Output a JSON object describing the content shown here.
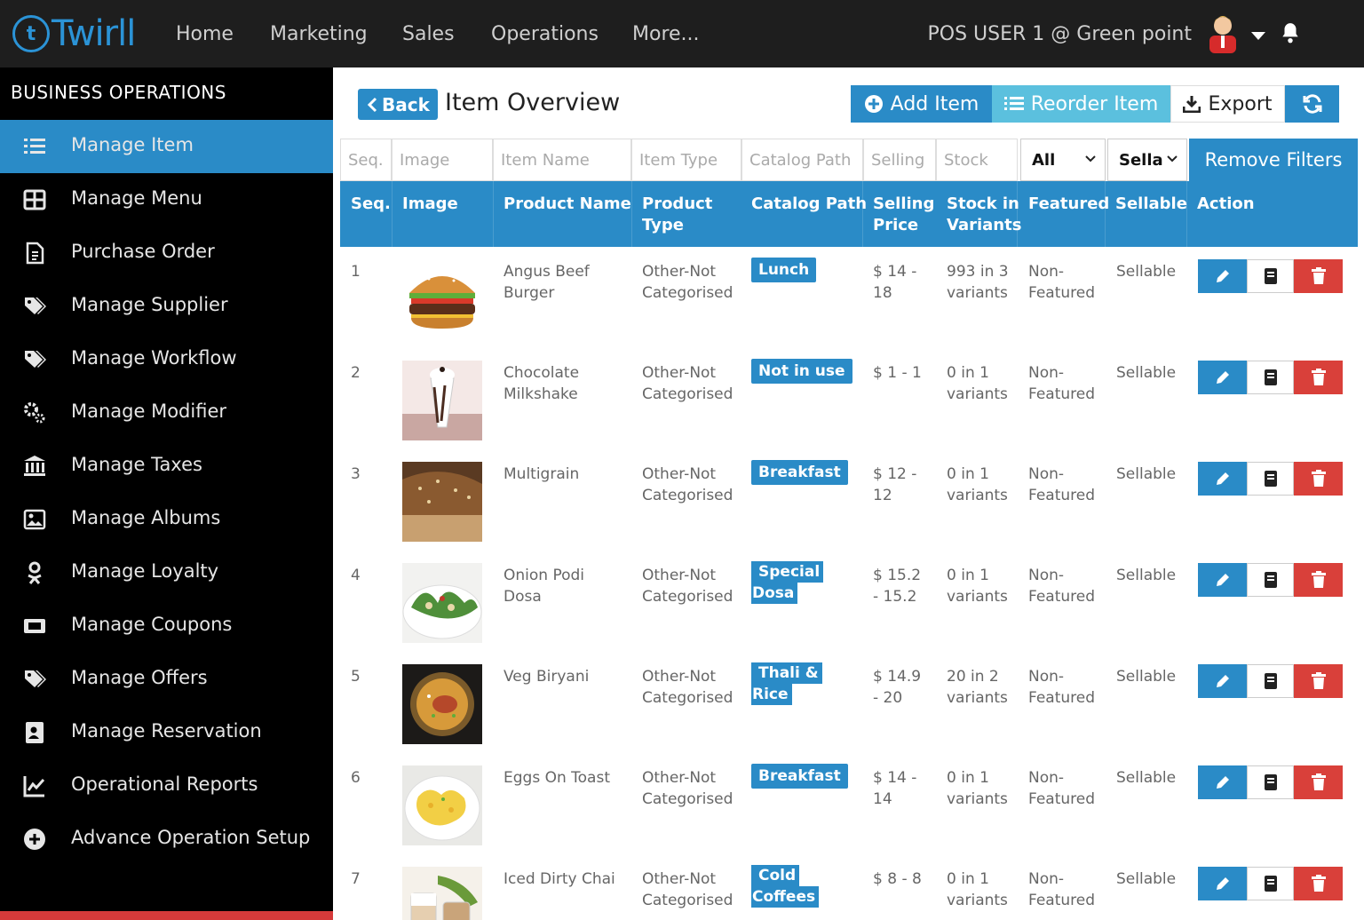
{
  "app": {
    "logo_mark": "t",
    "logo_text": "Twirll"
  },
  "nav": {
    "items": [
      "Home",
      "Marketing",
      "Sales",
      "Operations",
      "More..."
    ]
  },
  "user": {
    "label": "POS USER 1 @ Green point"
  },
  "sidebar": {
    "title": "BUSINESS OPERATIONS",
    "items": [
      {
        "label": "Manage Item",
        "icon": "list-icon",
        "active": true
      },
      {
        "label": "Manage Menu",
        "icon": "grid-icon"
      },
      {
        "label": "Purchase Order",
        "icon": "document-icon"
      },
      {
        "label": "Manage Supplier",
        "icon": "tags-icon"
      },
      {
        "label": "Manage Workflow",
        "icon": "tags-icon"
      },
      {
        "label": "Manage Modifier",
        "icon": "gears-icon"
      },
      {
        "label": "Manage Taxes",
        "icon": "bank-icon"
      },
      {
        "label": "Manage Albums",
        "icon": "image-icon"
      },
      {
        "label": "Manage Loyalty",
        "icon": "person-icon"
      },
      {
        "label": "Manage Coupons",
        "icon": "ticket-icon"
      },
      {
        "label": "Manage Offers",
        "icon": "tags-icon"
      },
      {
        "label": "Manage Reservation",
        "icon": "contact-icon"
      },
      {
        "label": "Operational Reports",
        "icon": "chart-icon"
      },
      {
        "label": "Advance Operation Setup",
        "icon": "plus-circle-icon"
      }
    ]
  },
  "header": {
    "back": "Back",
    "title": "Item Overview",
    "add": "Add Item",
    "reorder": "Reorder Item",
    "export": "Export"
  },
  "filters": {
    "seq": "Seq.",
    "image": "Image",
    "item_name": "Item Name",
    "item_type": "Item Type",
    "catalog_path": "Catalog Path",
    "selling": "Selling",
    "stock": "Stock",
    "featured_select": "All",
    "sellable_select": "Sella",
    "remove": "Remove Filters"
  },
  "columns": {
    "seq": "Seq.",
    "image": "Image",
    "name": "Product Name",
    "type_1": "Product",
    "type_2": "Type",
    "catalog": "Catalog Path",
    "price_1": "Selling",
    "price_2": "Price",
    "stock_1": "Stock in",
    "stock_2": "Variants",
    "featured": "Featured",
    "sellable": "Sellable",
    "action": "Action"
  },
  "rows": [
    {
      "seq": "1",
      "name_1": "Angus Beef",
      "name_2": "Burger",
      "type_1": "Other-Not",
      "type_2": "Categorised",
      "catalog_1": "Lunch",
      "catalog_2": "",
      "price_1": "$ 14 -",
      "price_2": "18",
      "stock_1": "993 in 3",
      "stock_2": "variants",
      "featured_1": "Non-",
      "featured_2": "Featured",
      "sellable": "Sellable"
    },
    {
      "seq": "2",
      "name_1": "Chocolate",
      "name_2": "Milkshake",
      "type_1": "Other-Not",
      "type_2": "Categorised",
      "catalog_1": "Not in use",
      "catalog_2": "",
      "price_1": "$ 1 - 1",
      "price_2": "",
      "stock_1": "0 in 1",
      "stock_2": "variants",
      "featured_1": "Non-",
      "featured_2": "Featured",
      "sellable": "Sellable"
    },
    {
      "seq": "3",
      "name_1": "Multigrain",
      "name_2": "",
      "type_1": "Other-Not",
      "type_2": "Categorised",
      "catalog_1": "Breakfast",
      "catalog_2": "",
      "price_1": "$ 12 -",
      "price_2": "12",
      "stock_1": "0 in 1",
      "stock_2": "variants",
      "featured_1": "Non-",
      "featured_2": "Featured",
      "sellable": "Sellable"
    },
    {
      "seq": "4",
      "name_1": "Onion Podi",
      "name_2": "Dosa",
      "type_1": "Other-Not",
      "type_2": "Categorised",
      "catalog_1": "Special",
      "catalog_2": "Dosa",
      "price_1": "$ 15.2",
      "price_2": "- 15.2",
      "stock_1": "0 in 1",
      "stock_2": "variants",
      "featured_1": "Non-",
      "featured_2": "Featured",
      "sellable": "Sellable"
    },
    {
      "seq": "5",
      "name_1": "Veg Biryani",
      "name_2": "",
      "type_1": "Other-Not",
      "type_2": "Categorised",
      "catalog_1": "Thali &",
      "catalog_2": "Rice",
      "price_1": "$ 14.9",
      "price_2": "- 20",
      "stock_1": "20 in 2",
      "stock_2": "variants",
      "featured_1": "Non-",
      "featured_2": "Featured",
      "sellable": "Sellable"
    },
    {
      "seq": "6",
      "name_1": "Eggs On Toast",
      "name_2": "",
      "type_1": "Other-Not",
      "type_2": "Categorised",
      "catalog_1": "Breakfast",
      "catalog_2": "",
      "price_1": "$ 14 -",
      "price_2": "14",
      "stock_1": "0 in 1",
      "stock_2": "variants",
      "featured_1": "Non-",
      "featured_2": "Featured",
      "sellable": "Sellable"
    },
    {
      "seq": "7",
      "name_1": "Iced Dirty Chai",
      "name_2": "",
      "type_1": "Other-Not",
      "type_2": "Categorised",
      "catalog_1": "Cold",
      "catalog_2": "Coffees",
      "price_1": "$ 8 - 8",
      "price_2": "",
      "stock_1": "0 in 1",
      "stock_2": "variants",
      "featured_1": "Non-",
      "featured_2": "Featured",
      "sellable": "Sellable"
    }
  ],
  "colors": {
    "accent": "#2a8bc7",
    "accent_light": "#5bc0de",
    "danger": "#d9403a",
    "topbar": "#1e1e1e",
    "sidebar": "#000000"
  }
}
